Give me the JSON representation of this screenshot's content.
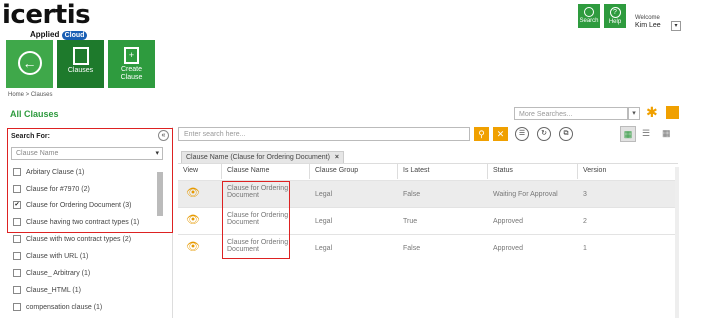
{
  "brand": {
    "name": "icertis",
    "applied": "Applied",
    "cloud": "Cloud"
  },
  "top_buttons": {
    "search": "Search",
    "help": "Help",
    "welcome": "Welcome",
    "user": "Kim Lee"
  },
  "tiles": {
    "clauses": "Clauses",
    "create": "Create Clause"
  },
  "breadcrumb": "Home > Clauses",
  "page_title": "All Clauses",
  "more_searches": "More Searches...",
  "filter": {
    "title": "Search For:",
    "dropdown": "Clause Name",
    "items": [
      {
        "label": "Arbitary Clause (1)",
        "checked": false
      },
      {
        "label": "Clause for #7970 (2)",
        "checked": false
      },
      {
        "label": "Clause for Ordering Document (3)",
        "checked": true
      },
      {
        "label": "Clause having two contract types (1)",
        "checked": false
      },
      {
        "label": "Clause with two contract types (2)",
        "checked": false
      },
      {
        "label": "Clause with URL (1)",
        "checked": false
      },
      {
        "label": "Clause_ Arbitrary (1)",
        "checked": false
      },
      {
        "label": "Clause_HTML (1)",
        "checked": false
      },
      {
        "label": "compensation clause (1)",
        "checked": false
      }
    ]
  },
  "grid": {
    "search_placeholder": "Enter search here...",
    "chip": "Clause Name (Clause for Ordering Document)",
    "columns": [
      "View",
      "Clause Name",
      "Clause Group",
      "Is Latest",
      "Status",
      "Version"
    ],
    "rows": [
      {
        "name1": "Clause for Ordering",
        "name2": "Document",
        "group": "Legal",
        "latest": "False",
        "status": "Waiting For Approval",
        "version": "3"
      },
      {
        "name1": "Clause for Ordering",
        "name2": "Document",
        "group": "Legal",
        "latest": "True",
        "status": "Approved",
        "version": "2"
      },
      {
        "name1": "Clause for Ordering",
        "name2": "Document",
        "group": "Legal",
        "latest": "False",
        "status": "Approved",
        "version": "1"
      }
    ]
  }
}
